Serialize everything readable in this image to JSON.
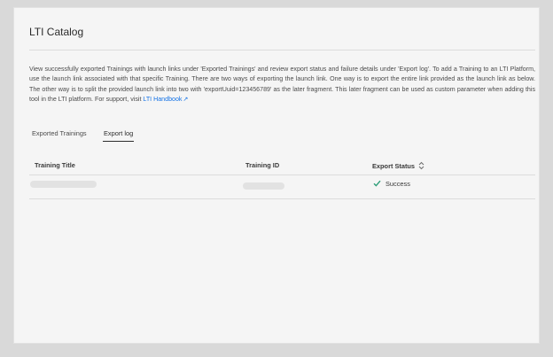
{
  "page": {
    "title": "LTI Catalog",
    "description": "View successfully exported Trainings with launch links under 'Exported Trainings' and review export status and failure details under 'Export log'. To add a Training to an LTI Platform, use the launch link associated with that specific Training. There are two ways of exporting the launch link. One way is to export the entire link provided as the launch link as below. The other way is to split the provided launch link into two with 'exportUuid=123456789' as the later fragment. This later fragment can be used as custom parameter when adding this tool in the LTI platform. For support, visit",
    "handbook_link": "LTI Handbook"
  },
  "tabs": [
    {
      "label": "Exported Trainings",
      "active": false
    },
    {
      "label": "Export log",
      "active": true
    }
  ],
  "table": {
    "columns": {
      "title": "Training Title",
      "id": "Training ID",
      "status": "Export Status"
    },
    "rows": [
      {
        "status": "Success"
      }
    ]
  },
  "icons": {
    "external": "external-link-icon",
    "sort": "sort-icon",
    "check": "check-icon"
  },
  "colors": {
    "link": "#1473e6",
    "success": "#2d9d78"
  }
}
